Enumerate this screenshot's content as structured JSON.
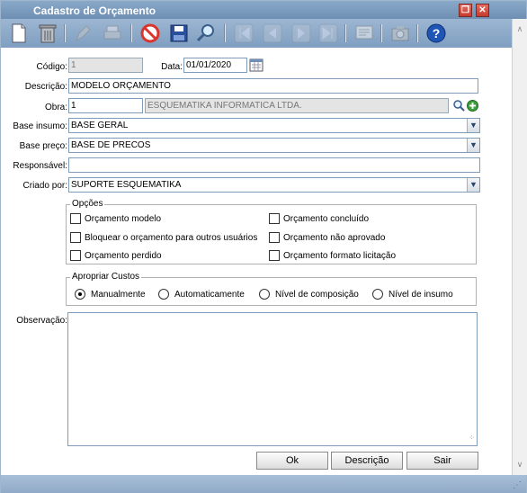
{
  "window": {
    "title": "Cadastro de Orçamento",
    "restore_glyph": "❐",
    "close_glyph": "✕"
  },
  "toolbar": {
    "icons": [
      "new-document-icon",
      "delete-icon",
      "edit-icon",
      "print-icon",
      "cancel-icon",
      "save-icon",
      "search-icon",
      "first-record-icon",
      "previous-record-icon",
      "next-record-icon",
      "last-record-icon",
      "notes-icon",
      "camera-icon",
      "help-icon"
    ]
  },
  "scrollbar": {
    "up": "∧",
    "down": "∨"
  },
  "form": {
    "codigo": {
      "label": "Código:",
      "value": "1"
    },
    "data": {
      "label": "Data:",
      "value": "01/01/2020"
    },
    "descricao": {
      "label": "Descrição:",
      "value": "MODELO ORÇAMENTO"
    },
    "obra": {
      "label": "Obra:",
      "code": "1",
      "name": "ESQUEMATIKA INFORMATICA LTDA."
    },
    "base_insumo": {
      "label": "Base insumo:",
      "value": "BASE GERAL"
    },
    "base_preco": {
      "label": "Base preço:",
      "value": "BASE DE PRECOS"
    },
    "responsavel": {
      "label": "Responsável:",
      "value": ""
    },
    "criado_por": {
      "label": "Criado por:",
      "value": "SUPORTE ESQUEMATIKA"
    },
    "combo_arrow": "▼"
  },
  "opcoes": {
    "title": "Opções",
    "items": [
      {
        "label": "Orçamento modelo",
        "checked": false
      },
      {
        "label": "Orçamento concluído",
        "checked": false
      },
      {
        "label": "Bloquear o orçamento para outros usuários",
        "checked": false
      },
      {
        "label": "Orçamento não aprovado",
        "checked": false
      },
      {
        "label": "Orçamento perdido",
        "checked": false
      },
      {
        "label": "Orçamento formato licitação",
        "checked": false
      }
    ]
  },
  "apropriar": {
    "title": "Apropriar Custos",
    "options": [
      {
        "label": "Manualmente",
        "selected": true
      },
      {
        "label": "Automaticamente",
        "selected": false
      },
      {
        "label": "Nível de composição",
        "selected": false
      },
      {
        "label": "Nível de insumo",
        "selected": false
      }
    ]
  },
  "observacao": {
    "label": "Observação:",
    "value": ""
  },
  "buttons": {
    "ok": "Ok",
    "descricao": "Descrição",
    "sair": "Sair"
  },
  "colors": {
    "titlebar": "#7a9bbf",
    "toolbar": "#8daac9",
    "accent_red": "#d9352c",
    "help_blue": "#1f56b5"
  }
}
